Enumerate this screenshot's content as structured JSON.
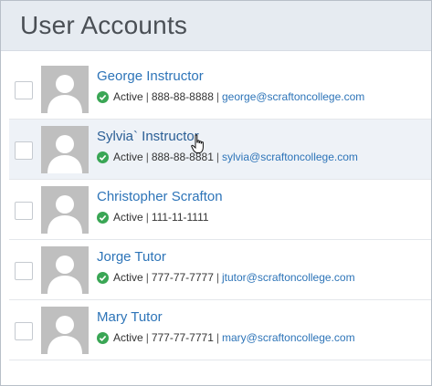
{
  "header": {
    "title": "User Accounts"
  },
  "users": [
    {
      "name": "George Instructor",
      "status": "Active",
      "phone": "888-88-8888",
      "email": "george@scraftoncollege.com"
    },
    {
      "name": "Sylvia` Instructor",
      "status": "Active",
      "phone": "888-88-8881",
      "email": "sylvia@scraftoncollege.com"
    },
    {
      "name": "Christopher Scrafton",
      "status": "Active",
      "phone": "111-11-1111",
      "email": ""
    },
    {
      "name": "Jorge Tutor",
      "status": "Active",
      "phone": "777-77-7777",
      "email": "jtutor@scraftoncollege.com"
    },
    {
      "name": "Mary Tutor",
      "status": "Active",
      "phone": "777-77-7771",
      "email": "mary@scraftoncollege.com"
    }
  ],
  "colors": {
    "link": "#2d74b8",
    "active_check": "#3aa655",
    "header_bg": "#e6ebf1",
    "hover_row": "#eef2f7"
  },
  "icons": {
    "status": "check-circle-icon",
    "avatar": "default-user-avatar-icon",
    "cursor": "hand-pointer-icon"
  }
}
